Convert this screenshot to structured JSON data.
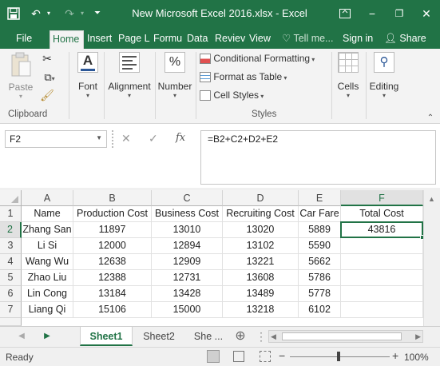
{
  "titlebar": {
    "title": "New Microsoft Excel 2016.xlsx - Excel",
    "save_icon": "🖫",
    "undo_icon": "↶",
    "redo_icon": "↷",
    "minimize_icon": "−",
    "restore_icon": "❐",
    "close_icon": "✕",
    "options_icon": "▣"
  },
  "tabs": [
    {
      "label": "File"
    },
    {
      "label": "Home"
    },
    {
      "label": "Insert"
    },
    {
      "label": "Page L"
    },
    {
      "label": "Formu"
    },
    {
      "label": "Data"
    },
    {
      "label": "Reviev"
    },
    {
      "label": "View"
    },
    {
      "label": "Tell me..."
    },
    {
      "label": "Sign in"
    },
    {
      "label": "Share"
    }
  ],
  "ribbon": {
    "paste": "Paste",
    "clipboard": "Clipboard",
    "font": "Font",
    "alignment": "Alignment",
    "number": "Number",
    "percent": "%",
    "conditional_formatting": "Conditional Formatting",
    "format_as_table": "Format as Table",
    "cell_styles": "Cell Styles",
    "styles": "Styles",
    "cells": "Cells",
    "editing": "Editing"
  },
  "formula_bar": {
    "name_box": "F2",
    "cancel_icon": "✕",
    "enter_icon": "✓",
    "fx": "fx",
    "formula": "=B2+C2+D2+E2"
  },
  "sheet": {
    "columns": [
      "A",
      "B",
      "C",
      "D",
      "E",
      "F"
    ],
    "rows": [
      "1",
      "2",
      "3",
      "4",
      "5",
      "6",
      "7"
    ],
    "cells": [
      [
        "Name",
        "Production Cost",
        "Business Cost",
        "Recruiting Cost",
        "Car Fare",
        "Total Cost"
      ],
      [
        "Zhang San",
        "11897",
        "13010",
        "13020",
        "5889",
        "43816"
      ],
      [
        "Li Si",
        "12000",
        "12894",
        "13102",
        "5590",
        ""
      ],
      [
        "Wang Wu",
        "12638",
        "12909",
        "13221",
        "5662",
        ""
      ],
      [
        "Zhao Liu",
        "12388",
        "12731",
        "13608",
        "5786",
        ""
      ],
      [
        "Lin Cong",
        "13184",
        "13428",
        "13489",
        "5778",
        ""
      ],
      [
        "Liang Qi",
        "15106",
        "15000",
        "13218",
        "6102",
        ""
      ]
    ],
    "selected_cell": "F2"
  },
  "sheet_tabs": {
    "items": [
      "Sheet1",
      "Sheet2",
      "She ..."
    ],
    "active": "Sheet1",
    "add_icon": "⊕"
  },
  "status": {
    "ready": "Ready",
    "zoom": "100%",
    "zoom_out": "−",
    "zoom_in": "+"
  },
  "colors": {
    "brand": "#217346",
    "ribbon_bg": "#f3f3f3"
  }
}
